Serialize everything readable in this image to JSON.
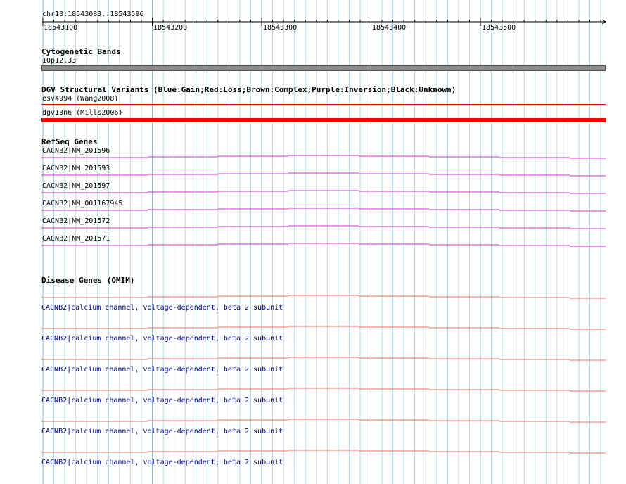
{
  "ruler": {
    "location": "chr10:18543083..18543596",
    "ticks": [
      "18543100",
      "18543200",
      "18543300",
      "18543400",
      "18543500"
    ]
  },
  "cytoband": {
    "title": "Cytogenetic Bands",
    "band": "10p12.33",
    "color": "#8c8c8c"
  },
  "dgv": {
    "title": "DGV Structural Variants (Blue:Gain;Red:Loss;Brown:Complex;Purple:Inversion;Black:Unknown)",
    "items": [
      {
        "label": "esv4994 (Wang2008)",
        "color": "#ff0000"
      },
      {
        "label": "dgv13n6 (Mills2006)",
        "color": "#ff0000"
      }
    ]
  },
  "refseq": {
    "title": "RefSeq Genes",
    "color": "#cc33cc",
    "items": [
      {
        "label": "CACNB2|NM_201596"
      },
      {
        "label": "CACNB2|NM_201593"
      },
      {
        "label": "CACNB2|NM_201597"
      },
      {
        "label": "CACNB2|NM_001167945"
      },
      {
        "label": "CACNB2|NM_201572"
      },
      {
        "label": "CACNB2|NM_201571"
      }
    ]
  },
  "omim": {
    "title": "Disease Genes (OMIM)",
    "color": "#e8735a",
    "items": [
      {
        "label": "CACNB2|calcium channel, voltage-dependent, beta 2 subunit"
      },
      {
        "label": "CACNB2|calcium channel, voltage-dependent, beta 2 subunit"
      },
      {
        "label": "CACNB2|calcium channel, voltage-dependent, beta 2 subunit"
      },
      {
        "label": "CACNB2|calcium channel, voltage-dependent, beta 2 subunit"
      },
      {
        "label": "CACNB2|calcium channel, voltage-dependent, beta 2 subunit"
      },
      {
        "label": "CACNB2|calcium channel, voltage-dependent, beta 2 subunit"
      }
    ]
  },
  "colors": {
    "grid": "#add8e6",
    "grid_major": "#87b8d8"
  }
}
